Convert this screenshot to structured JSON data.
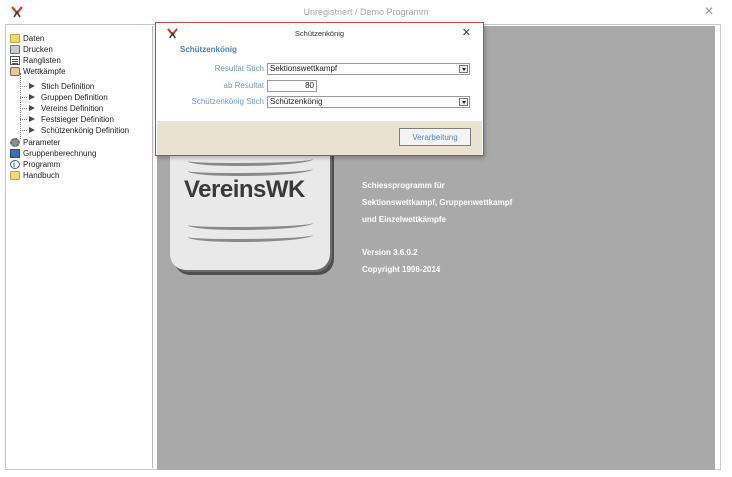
{
  "window": {
    "title": "Unregistriert / Demo Programm",
    "close_glyph": "✕"
  },
  "tree": {
    "items": [
      {
        "label": "Daten",
        "icon": "folder-icon"
      },
      {
        "label": "Drucken",
        "icon": "printer-icon"
      },
      {
        "label": "Ranglisten",
        "icon": "list-icon"
      },
      {
        "label": "Wettkämpfe",
        "icon": "target-icon"
      },
      {
        "label": "Stich Definition",
        "icon": "arrow-icon"
      },
      {
        "label": "Gruppen Definition",
        "icon": "arrow-icon"
      },
      {
        "label": "Vereins Definition",
        "icon": "arrow-icon"
      },
      {
        "label": "Festsieger Definition",
        "icon": "arrow-icon"
      },
      {
        "label": "Schützenkönig Definition",
        "icon": "arrow-icon"
      },
      {
        "label": "Parameter",
        "icon": "gear-icon"
      },
      {
        "label": "Gruppenberechnung",
        "icon": "calculator-icon"
      },
      {
        "label": "Programm",
        "icon": "info-icon"
      },
      {
        "label": "Handbuch",
        "icon": "folder-icon"
      }
    ]
  },
  "logo": {
    "text": "VereinsWK",
    "accent": "#e53a1e"
  },
  "info": {
    "line1": "Schiessprogramm für",
    "line2": "Sektionswettkampf, Gruppenwettkampf",
    "line3": "und Einzelwettkämpfe",
    "version": "Version 3.6.0.2",
    "copyright": "Copyright  1996-2014"
  },
  "dialog": {
    "title": "Schützenkönig",
    "close_glyph": "✕",
    "section": "Schützenkönig",
    "resultat_stich_label": "Resultat Stich",
    "resultat_stich_value": "Sektionswettkampf",
    "ab_resultat_label": "ab Resultat",
    "ab_resultat_value": "80",
    "koenig_stich_label": "Schützenkönig Stich",
    "koenig_stich_value": "Schützenkönig",
    "run_button": "Verarbeitung"
  },
  "colors": {
    "content_bg": "#a9a9a9",
    "label_blue": "#4a86c5",
    "dialog_border": "#c24848",
    "footer_bg": "#e9e2d0"
  }
}
